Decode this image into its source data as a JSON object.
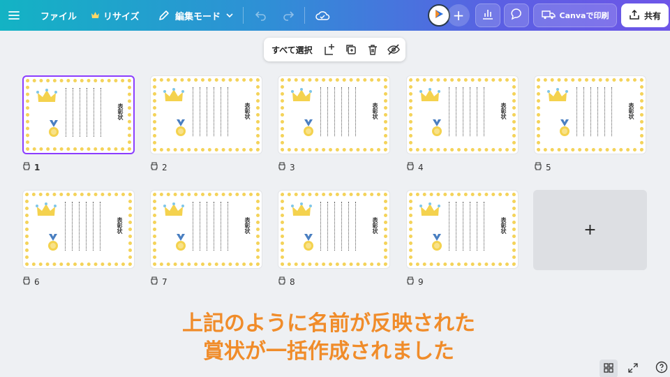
{
  "topbar": {
    "file_label": "ファイル",
    "resize_label": "リサイズ",
    "edit_mode_label": "編集モード",
    "print_label": "Canvaで印刷",
    "share_label": "共有"
  },
  "float_toolbar": {
    "select_all_label": "すべて選択"
  },
  "certificate": {
    "title": "表彰状"
  },
  "pages": [
    {
      "number": "1",
      "selected": true
    },
    {
      "number": "2",
      "selected": false
    },
    {
      "number": "3",
      "selected": false
    },
    {
      "number": "4",
      "selected": false
    },
    {
      "number": "5",
      "selected": false
    },
    {
      "number": "6",
      "selected": false
    },
    {
      "number": "7",
      "selected": false
    },
    {
      "number": "8",
      "selected": false
    },
    {
      "number": "9",
      "selected": false
    }
  ],
  "add_page_symbol": "+",
  "caption": {
    "line1": "上記のように名前が反映された",
    "line2": "賞状が一括作成されました"
  },
  "colors": {
    "accent": "#8b3dff",
    "caption": "#f08c2a",
    "star": "#f4d35a"
  }
}
